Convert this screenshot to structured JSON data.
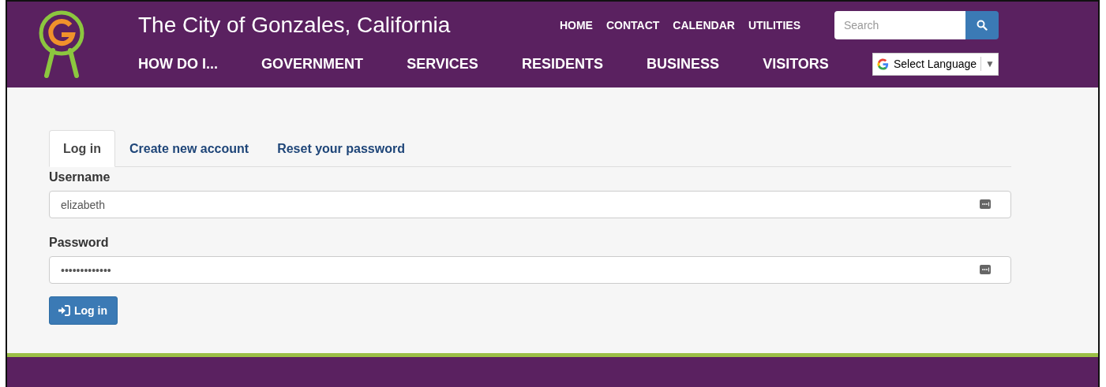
{
  "header": {
    "site_title": "The City of Gonzales, California",
    "top_links": [
      "HOME",
      "CONTACT",
      "CALENDAR",
      "UTILITIES"
    ],
    "search": {
      "placeholder": "Search"
    },
    "nav": [
      "HOW DO I...",
      "GOVERNMENT",
      "SERVICES",
      "RESIDENTS",
      "BUSINESS",
      "VISITORS"
    ],
    "language_select": {
      "value": "Select Language",
      "arrow": "▼"
    }
  },
  "tabs": [
    {
      "label": "Log in",
      "selected": true
    },
    {
      "label": "Create new account",
      "selected": false
    },
    {
      "label": "Reset your password",
      "selected": false
    }
  ],
  "fields": [
    {
      "label": "Username",
      "value": "elizabeth"
    },
    {
      "label": "Password",
      "value": "•••••••••••••"
    }
  ],
  "submit_button": "Log in"
}
